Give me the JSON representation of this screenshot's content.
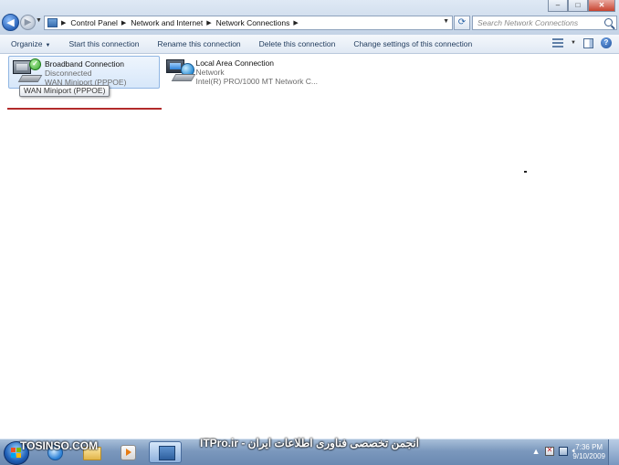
{
  "window": {
    "minimize_icon": "minimize-icon",
    "maximize_icon": "maximize-icon",
    "close_icon": "close-icon",
    "minimize_glyph": "–",
    "maximize_glyph": "□",
    "close_glyph": "✕"
  },
  "address": {
    "breadcrumbs": [
      "Control Panel",
      "Network and Internet",
      "Network Connections"
    ],
    "search_placeholder": "Search Network Connections"
  },
  "toolbar": {
    "organize": "Organize",
    "start": "Start this connection",
    "rename": "Rename this connection",
    "delete": "Delete this connection",
    "change": "Change settings of this connection"
  },
  "connections": [
    {
      "name": "Broadband Connection",
      "status": "Disconnected",
      "device": "WAN Miniport (PPPOE)",
      "selected": true,
      "icon": "broadband-connection-icon"
    },
    {
      "name": "Local Area Connection",
      "status": "Network",
      "device": "Intel(R) PRO/1000 MT Network C...",
      "selected": false,
      "icon": "local-area-connection-icon"
    }
  ],
  "tooltip": "WAN Miniport (PPPOE)",
  "taskbar": {
    "watermark_left": "TOSINSO.COM",
    "watermark_mid": "ITPro.ir - انجمن تخصصی فناوری اطلاعات ایران",
    "time": "7:36 PM",
    "date": "9/10/2009"
  },
  "colors": {
    "selection_border": "#90b6e3",
    "command_text": "#1e395b",
    "red_underline": "#b22b2b"
  }
}
